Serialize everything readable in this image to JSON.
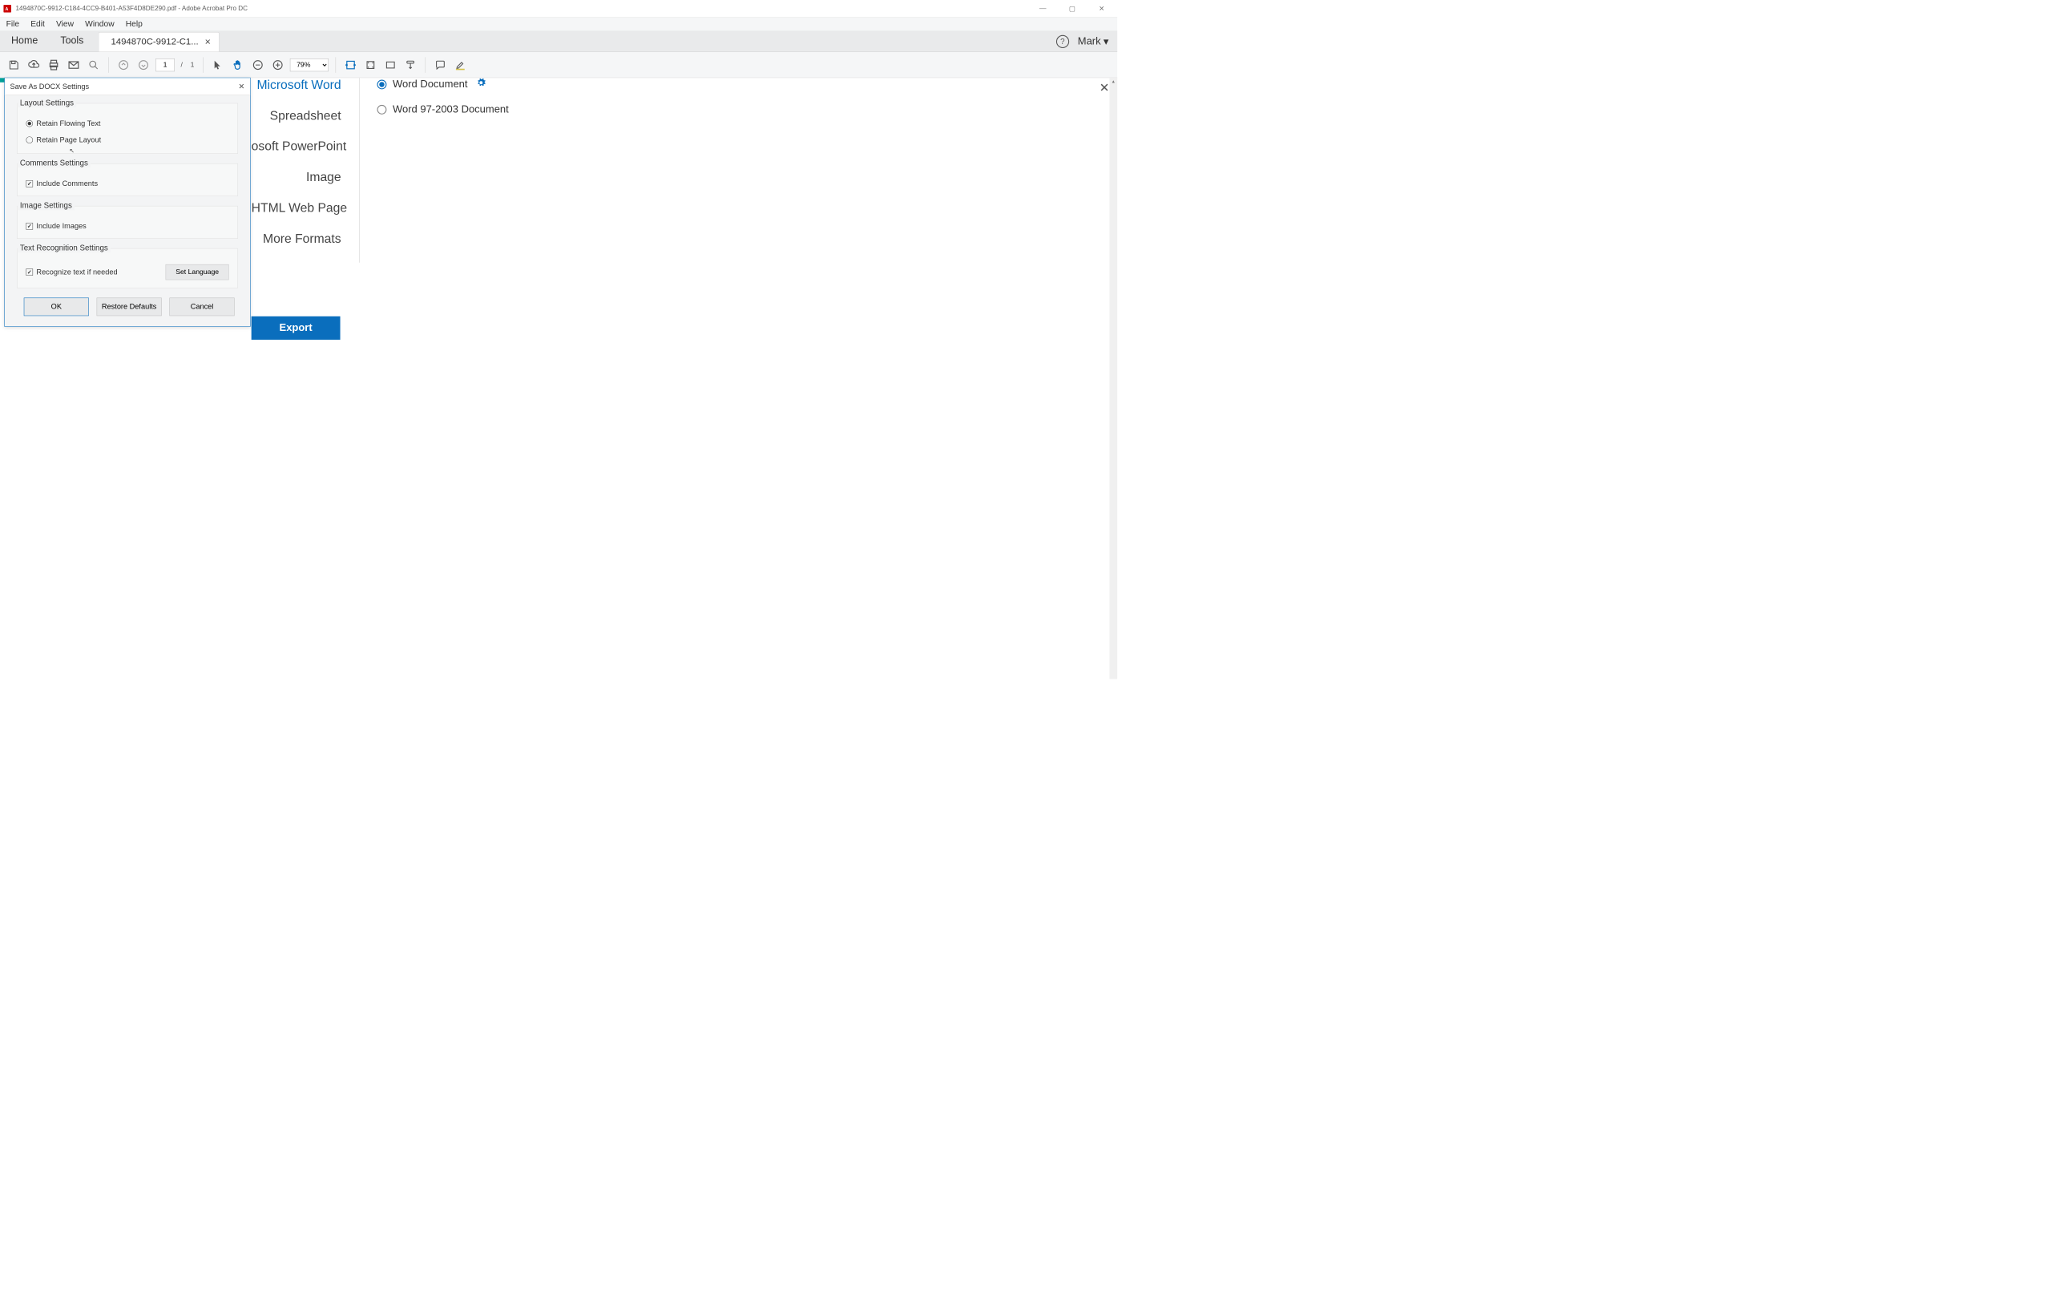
{
  "window": {
    "title": "1494870C-9912-C184-4CC9-B401-A53F4D8DE290.pdf - Adobe Acrobat Pro DC"
  },
  "menu": {
    "file": "File",
    "edit": "Edit",
    "view": "View",
    "window": "Window",
    "help": "Help"
  },
  "tabs": {
    "home": "Home",
    "tools": "Tools",
    "doc": "1494870C-9912-C1..."
  },
  "tab_right": {
    "user": "Mark"
  },
  "toolbar": {
    "page_current": "1",
    "page_separator": "/",
    "page_total": "1",
    "zoom": "79%"
  },
  "export": {
    "items": [
      "Microsoft Word",
      "Spreadsheet",
      "osoft PowerPoint",
      "Image",
      "HTML Web Page",
      "More Formats"
    ],
    "options": [
      {
        "label": "Word Document",
        "selected": true,
        "gear": true
      },
      {
        "label": "Word 97-2003 Document",
        "selected": false,
        "gear": false
      }
    ],
    "button": "Export"
  },
  "dialog": {
    "title": "Save As DOCX Settings",
    "layout_settings": "Layout Settings",
    "retain_flowing": "Retain Flowing Text",
    "retain_page": "Retain Page Layout",
    "comments_settings": "Comments Settings",
    "include_comments": "Include Comments",
    "image_settings": "Image Settings",
    "include_images": "Include Images",
    "text_recog_settings": "Text Recognition Settings",
    "recognize_text": "Recognize text if needed",
    "set_language": "Set Language",
    "ok": "OK",
    "restore_defaults": "Restore Defaults",
    "cancel": "Cancel"
  }
}
